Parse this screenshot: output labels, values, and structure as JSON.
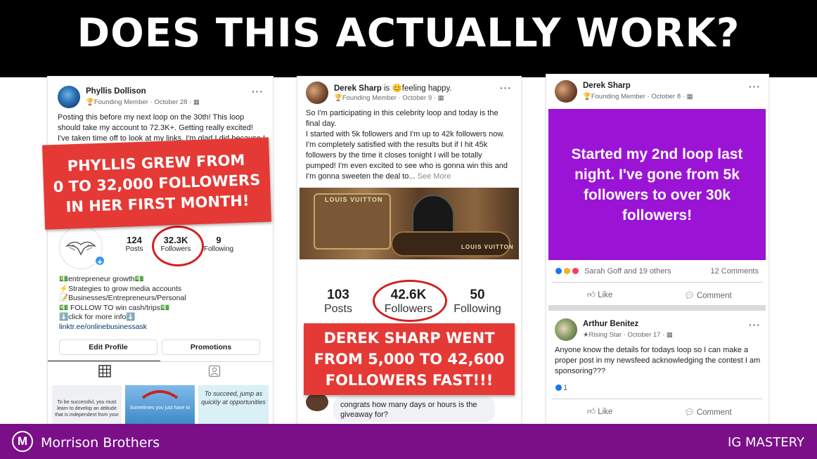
{
  "headline": "DOES THIS ACTUALLY WORK?",
  "phyllis": {
    "author": "Phyllis Dollison",
    "badge": "Founding Member",
    "date": "October 28",
    "post_text": "Posting this before my next loop on the 30th! This loop should take my account to 72.3K+. Getting really excited! I've taken time off to look at my links. I'm glad I did because I was",
    "banner": [
      "PHYLLIS GREW FROM",
      "0 TO 32,000 FOLLOWERS",
      "IN HER FIRST MONTH!"
    ],
    "stats": [
      {
        "value": "124",
        "label": "Posts"
      },
      {
        "value": "32.3K",
        "label": "Followers"
      },
      {
        "value": "9",
        "label": "Following"
      }
    ],
    "bio": [
      "💵entrepreneur growth💵",
      "⚡Strategies to grow media accounts",
      "📝Businesses/Entrepreneurs/Personal",
      "💵 FOLLOW TO win cash/trips💵",
      "⬇️click for more info⬇️"
    ],
    "bio_link": "linktr.ee/onlinebusinessask",
    "edit_profile": "Edit Profile",
    "promotions": "Promotions",
    "thumbs": [
      "To be successful, you must learn to develop an attitude that is independent from your",
      "Sometimes you just have to",
      "To succeed, jump as quickly at opportunities"
    ]
  },
  "derek": {
    "author": "Derek Sharp",
    "mood_prefix": " is ",
    "mood": "😊feeling happy.",
    "badge": "Founding Member",
    "date": "October 9",
    "post_text": "So I'm participating in this celebrity loop and today is the final day.\nI started with 5k followers and I'm up to 42k followers now.  I'm completely satisfied with the results but if I hit 45k followers by the time it closes tonight I will be totally pumped!  I'm even excited to see who is gonna win this and I'm gonna sweeten the deal to...",
    "see_more": "See More",
    "photo_text_1": "LOUIS VUITTON",
    "photo_text_2": "LOUIS VUITTON",
    "stats": [
      {
        "value": "103",
        "label": "Posts"
      },
      {
        "value": "42.6K",
        "label": "Followers"
      },
      {
        "value": "50",
        "label": "Following"
      }
    ],
    "banner": [
      "DEREK SHARP WENT",
      "FROM 5,000 TO 42,600",
      "FOLLOWERS FAST!!!"
    ],
    "comment_text": "congrats how many days or hours is the giveaway for?"
  },
  "right": {
    "author": "Derek Sharp",
    "badge": "Founding Member",
    "date": "October 8",
    "card_text": "Started my 2nd loop last night.  I've gone from 5k followers to over 30k followers!",
    "reactions": "Sarah Goff and 19 others",
    "comments_count": "12 Comments",
    "like": "Like",
    "comment": "Comment",
    "comment_author": "Arthur Benitez",
    "comment_badge": "Rising Star",
    "comment_date": "October 17",
    "comment_body": "Anyone know the details for todays loop so I can make a proper post in my newsfeed acknowledging the contest I am sponsoring???",
    "comment_likes": "1",
    "like_2": "Like",
    "comment_2": "Comment"
  },
  "footer": {
    "brand": "Morrison Brothers",
    "course": "IG MASTERY"
  },
  "colors": {
    "banner_red": "#e53935",
    "card_purple": "#9b14d6",
    "footer_purple": "#7a0f88"
  }
}
